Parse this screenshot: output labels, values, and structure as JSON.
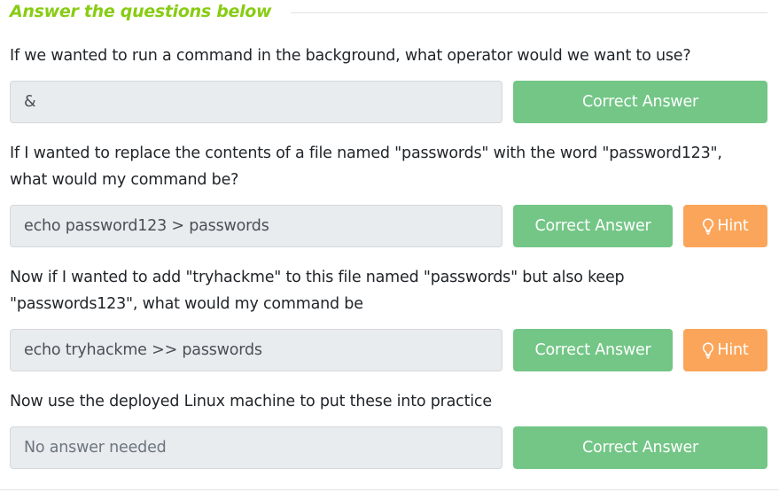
{
  "section": {
    "title": "Answer the questions below"
  },
  "questions": [
    {
      "lines": [
        "If we wanted to run a command in the background, what operator would we want to use?"
      ],
      "answer": "&",
      "correct_label": "Correct Answer"
    },
    {
      "lines": [
        "If I wanted to replace the contents of a file named \"passwords\" with the word \"password123\",",
        "what would my command be?"
      ],
      "answer": "echo password123 > passwords",
      "correct_label": "Correct Answer",
      "hint_label": "Hint"
    },
    {
      "lines": [
        "Now if I wanted to add \"tryhackme\" to this file named \"passwords\" but also keep",
        "\"passwords123\", what would my command be"
      ],
      "answer": "echo tryhackme >> passwords",
      "correct_label": "Correct Answer",
      "hint_label": "Hint"
    },
    {
      "lines": [
        "Now use the deployed Linux machine to put these into practice"
      ],
      "placeholder": "No answer needed",
      "correct_label": "Correct Answer"
    }
  ],
  "icons": {
    "hint": "lightbulb-icon"
  },
  "colors": {
    "title": "#88cc14",
    "correct": "#73c686",
    "hint": "#fba55a",
    "input_bg": "#e9ecef"
  }
}
